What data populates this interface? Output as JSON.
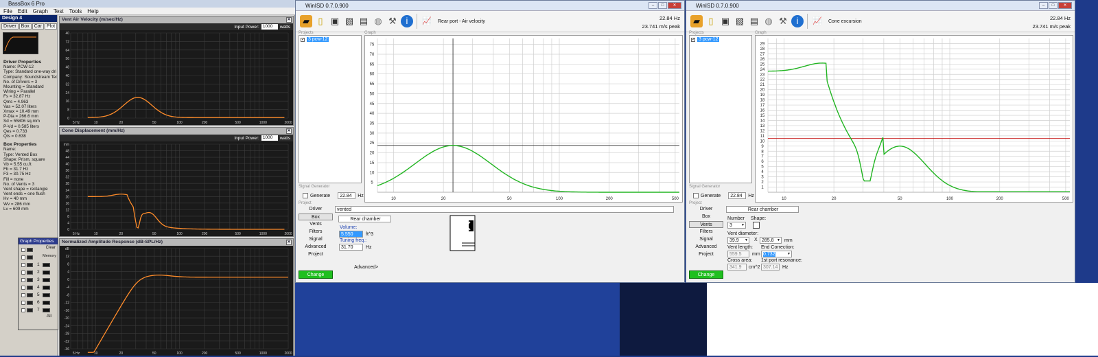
{
  "colors": {
    "vent": "#ff8c2a",
    "green": "#22b522",
    "red": "#c00000"
  },
  "bassbox": {
    "title": "BassBox 6 Pro",
    "menu": [
      "File",
      "Edit",
      "Graph",
      "Test",
      "Tools",
      "Help"
    ],
    "design_title": "Design 4",
    "tabs": [
      "Driver",
      "Box",
      "Car",
      "Plot"
    ],
    "driver_header": "Driver Properties",
    "driver_props": [
      "Name: PCW-12",
      "Type: Standard one-way dri",
      "Company: Soundstream Tec",
      "No. of Drivers = 3",
      "Mounting = Standard",
      "Wiring = Parallel",
      "Fs = 32.87 Hz",
      "Qms = 4.963",
      "Vas = 52.07 liters",
      "Xmax = 10.49 mm",
      "P-Dia = 266.6 mm",
      "Sd = 55806 sq.mm",
      "P-Vd = 0.585 liters",
      "Qes = 0.733",
      "Qts = 0.638"
    ],
    "box_header": "Box Properties",
    "box_props": [
      "Name:",
      "Type: Vented Box",
      "Shape: Prism, square",
      "Vb = 5.55 cu.ft",
      "Fb = 31.7 Hz",
      "F3 = 30.75 Hz",
      "Fill = none",
      "No. of Vents = 3",
      "Vent shape = rectangle",
      "Vent ends = one flush",
      "Hv = 40 mm",
      "Wv = 286 mm",
      "Lv = 609 mm"
    ],
    "graph_props": {
      "title": "Graph Properties",
      "memory_label": "Memory",
      "clear_label": "Clear",
      "all_label": "All",
      "rows": [
        "1",
        "2",
        "3",
        "4",
        "5",
        "6",
        "7"
      ]
    },
    "panels": [
      {
        "title": "Vent Air Velocity (m/sec/Hz)",
        "input_label": "Input Power:",
        "input_value": "1000",
        "unit": "watts",
        "y_ticks": [
          "40",
          "72",
          "64",
          "56",
          "48",
          "40",
          "32",
          "24",
          "16",
          "8",
          "0"
        ]
      },
      {
        "title": "Cone Displacement (mm/Hz)",
        "input_label": "Input Power:",
        "input_value": "1000",
        "unit": "watts",
        "y_ticks": [
          "mm",
          "48",
          "44",
          "40",
          "36",
          "32",
          "28",
          "24",
          "20",
          "16",
          "12",
          "8",
          "4",
          "0"
        ]
      },
      {
        "title": "Normalized Amplitude Response (dB-SPL/Hz)",
        "y_ticks": [
          "dB",
          "12",
          "8",
          "4",
          "0",
          "-4",
          "-8",
          "-12",
          "-16",
          "-20",
          "-24",
          "-28",
          "-32",
          "-36"
        ]
      }
    ],
    "x_ticks": [
      "5 Hz",
      "10",
      "20",
      "50",
      "100",
      "200",
      "500",
      "1000",
      "2000"
    ]
  },
  "winisd1": {
    "title": "WinISD 0.7.0.900",
    "graph_mode": "Rear port - Air velocity",
    "readout_freq": "22.84 Hz",
    "readout_value": "23.741 m/s peak",
    "projects_label": "Projects",
    "graph_label": "Graph",
    "project_item": "3 pcw-12",
    "signal_label": "Signal Generator",
    "generate_label": "Generate",
    "generate_value": "22.84",
    "hz": "Hz",
    "project_label": "Project",
    "nav": [
      "Driver",
      "Box",
      "Vents",
      "Filters",
      "Signal",
      "Advanced",
      "Project"
    ],
    "change_label": "Change",
    "box_type": "vented",
    "chamber_label": "Rear chamber",
    "volume_label": "Volume:",
    "volume_value": "5.550",
    "volume_unit": "ft^3",
    "tuning_label": "Tuning freq.:",
    "tuning_value": "31.70",
    "tuning_unit": "Hz",
    "advanced_label": "Advanced>",
    "y_ticks": [
      "75",
      "70",
      "65",
      "60",
      "55",
      "50",
      "45",
      "40",
      "35",
      "30",
      "25",
      "20",
      "15",
      "10",
      "5"
    ],
    "x_ticks": [
      "10",
      "20",
      "50",
      "100",
      "200",
      "500"
    ]
  },
  "winisd2": {
    "title": "WinISD 0.7.0.900",
    "graph_mode": "Cone excursion",
    "readout_freq": "22.84 Hz",
    "readout_value": "23.741 m/s peak",
    "projects_label": "Projects",
    "graph_label": "Graph",
    "project_item": "3 pcw-12",
    "signal_label": "Signal Generator",
    "generate_label": "Generate",
    "generate_value": "22.84",
    "hz": "Hz",
    "project_label": "Project",
    "nav": [
      "Driver",
      "Box",
      "Vents",
      "Filters",
      "Signal",
      "Advanced",
      "Project"
    ],
    "change_label": "Change",
    "chamber_label": "Rear chamber",
    "number_label": "Number",
    "number_value": "3",
    "shape_label": "Shape:",
    "diameter_label": "Vent diameter:",
    "diameter_a": "39.9",
    "times": "X",
    "diameter_b": "285.8",
    "mm": "mm",
    "length_label": "Vent length:",
    "length_value": "559.5",
    "end_corr_label": "End Correction:",
    "end_corr_value": "0.732",
    "cross_label": "Cross area:",
    "cross_value": "341.9",
    "cross_unit": "cm^2",
    "resonance_label": "1st port resonance:",
    "resonance_value": "307.14",
    "resonance_unit": "Hz",
    "y_ticks": [
      "29",
      "28",
      "27",
      "26",
      "25",
      "24",
      "23",
      "22",
      "21",
      "20",
      "19",
      "18",
      "17",
      "16",
      "15",
      "14",
      "13",
      "12",
      "11",
      "10",
      "9",
      "8",
      "7",
      "6",
      "5",
      "4",
      "3",
      "2",
      "1"
    ],
    "x_ticks": [
      "10",
      "20",
      "50",
      "100",
      "200",
      "500"
    ]
  }
}
